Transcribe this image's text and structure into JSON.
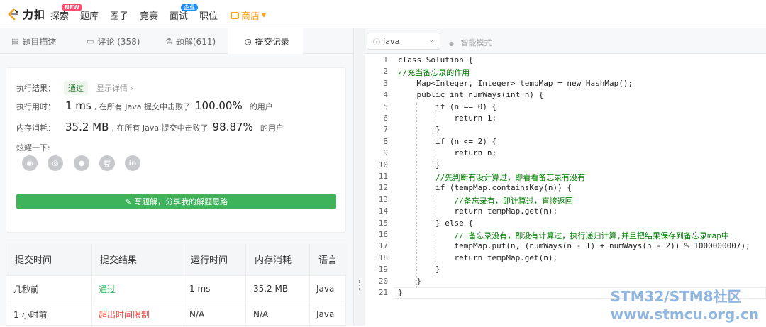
{
  "brand": {
    "name": "力扣"
  },
  "nav": [
    {
      "label": "探索",
      "badge": "NEW"
    },
    {
      "label": "题库"
    },
    {
      "label": "圈子"
    },
    {
      "label": "竞赛"
    },
    {
      "label": "面试",
      "badge": "企业"
    },
    {
      "label": "职位"
    },
    {
      "label": "商店"
    }
  ],
  "tabs": [
    {
      "label": "题目描述",
      "icon": "description-icon"
    },
    {
      "label": "评论 (358)",
      "icon": "comment-icon"
    },
    {
      "label": "题解(611)",
      "icon": "flask-icon"
    },
    {
      "label": "提交记录",
      "icon": "clock-icon"
    }
  ],
  "result": {
    "status_label": "执行结果：",
    "status_value": "通过",
    "detail_link": "显示详情 ›",
    "time_label": "执行用时：",
    "time_value": "1 ms",
    "time_text": ", 在所有 Java 提交中击败了",
    "time_pct": "100.00%",
    "time_suffix": "的用户",
    "mem_label": "内存消耗：",
    "mem_value": "35.2 MB",
    "mem_text": ", 在所有 Java 提交中击败了",
    "mem_pct": "98.87%",
    "mem_suffix": "的用户",
    "share_label": "炫耀一下:",
    "share_icons": [
      "wechat-icon",
      "weibo-icon",
      "qq-icon",
      "douban-icon",
      "linkedin-icon"
    ],
    "write_button": "写题解，分享我的解题思路"
  },
  "submissions": {
    "headers": [
      "提交时间",
      "提交结果",
      "运行时间",
      "内存消耗",
      "语言"
    ],
    "rows": [
      {
        "time": "几秒前",
        "result": "通过",
        "runtime": "1 ms",
        "memory": "35.2 MB",
        "lang": "Java",
        "status": "ok"
      },
      {
        "time": "1 小时前",
        "result": "超出时间限制",
        "runtime": "N/A",
        "memory": "N/A",
        "lang": "Java",
        "status": "err"
      }
    ]
  },
  "editor": {
    "language": "Java",
    "smart_mode": "智能模式",
    "lines": [
      "class Solution {",
      "//充当备忘录的作用",
      "    Map<Integer, Integer> tempMap = new HashMap();",
      "    public int numWays(int n) {",
      "        if (n == 0) {",
      "            return 1;",
      "        }",
      "        if (n <= 2) {",
      "            return n;",
      "        }",
      "        //先判断有没计算过，即看看备忘录有没有",
      "        if (tempMap.containsKey(n)) {",
      "            //备忘录有，即计算过，直接返回",
      "            return tempMap.get(n);",
      "        } else {",
      "            // 备忘录没有，即没有计算过，执行递归计算,并且把结果保存到备忘录map中",
      "            tempMap.put(n, (numWays(n - 1) + numWays(n - 2)) % 1000000007);",
      "            return tempMap.get(n);",
      "        }",
      "    }",
      "}"
    ]
  },
  "watermark": {
    "line1": "STM32/STM8社区",
    "line2": "www.stmcu.org.cn"
  }
}
